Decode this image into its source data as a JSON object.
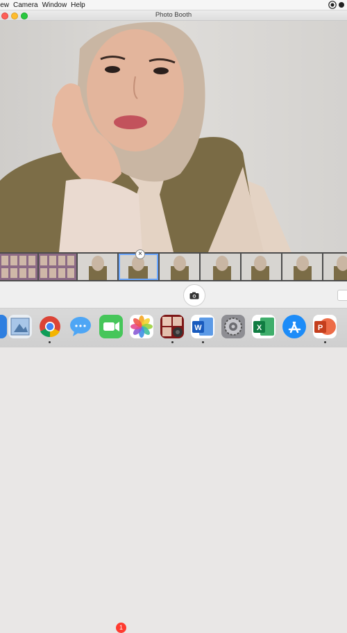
{
  "menubar": {
    "items": [
      {
        "label": "iew"
      },
      {
        "label": "Camera"
      },
      {
        "label": "Window"
      },
      {
        "label": "Help"
      }
    ]
  },
  "window": {
    "title": "Photo Booth"
  },
  "strip": {
    "thumbnail_count": 10,
    "selected_index": 3
  },
  "dock": {
    "apps": [
      {
        "name": "Finder"
      },
      {
        "name": "Preview"
      },
      {
        "name": "Google Chrome"
      },
      {
        "name": "Messages"
      },
      {
        "name": "FaceTime",
        "badge": "1"
      },
      {
        "name": "Photos"
      },
      {
        "name": "Photo Booth"
      },
      {
        "name": "Microsoft Word"
      },
      {
        "name": "System Preferences"
      },
      {
        "name": "Microsoft Excel"
      },
      {
        "name": "App Store"
      },
      {
        "name": "Microsoft PowerPoint"
      }
    ]
  },
  "colors": {
    "close": "#fd5f57",
    "minimize": "#febc2e",
    "zoom": "#2ac840",
    "selection": "#6aa7ff",
    "badge": "#ff3b30"
  }
}
